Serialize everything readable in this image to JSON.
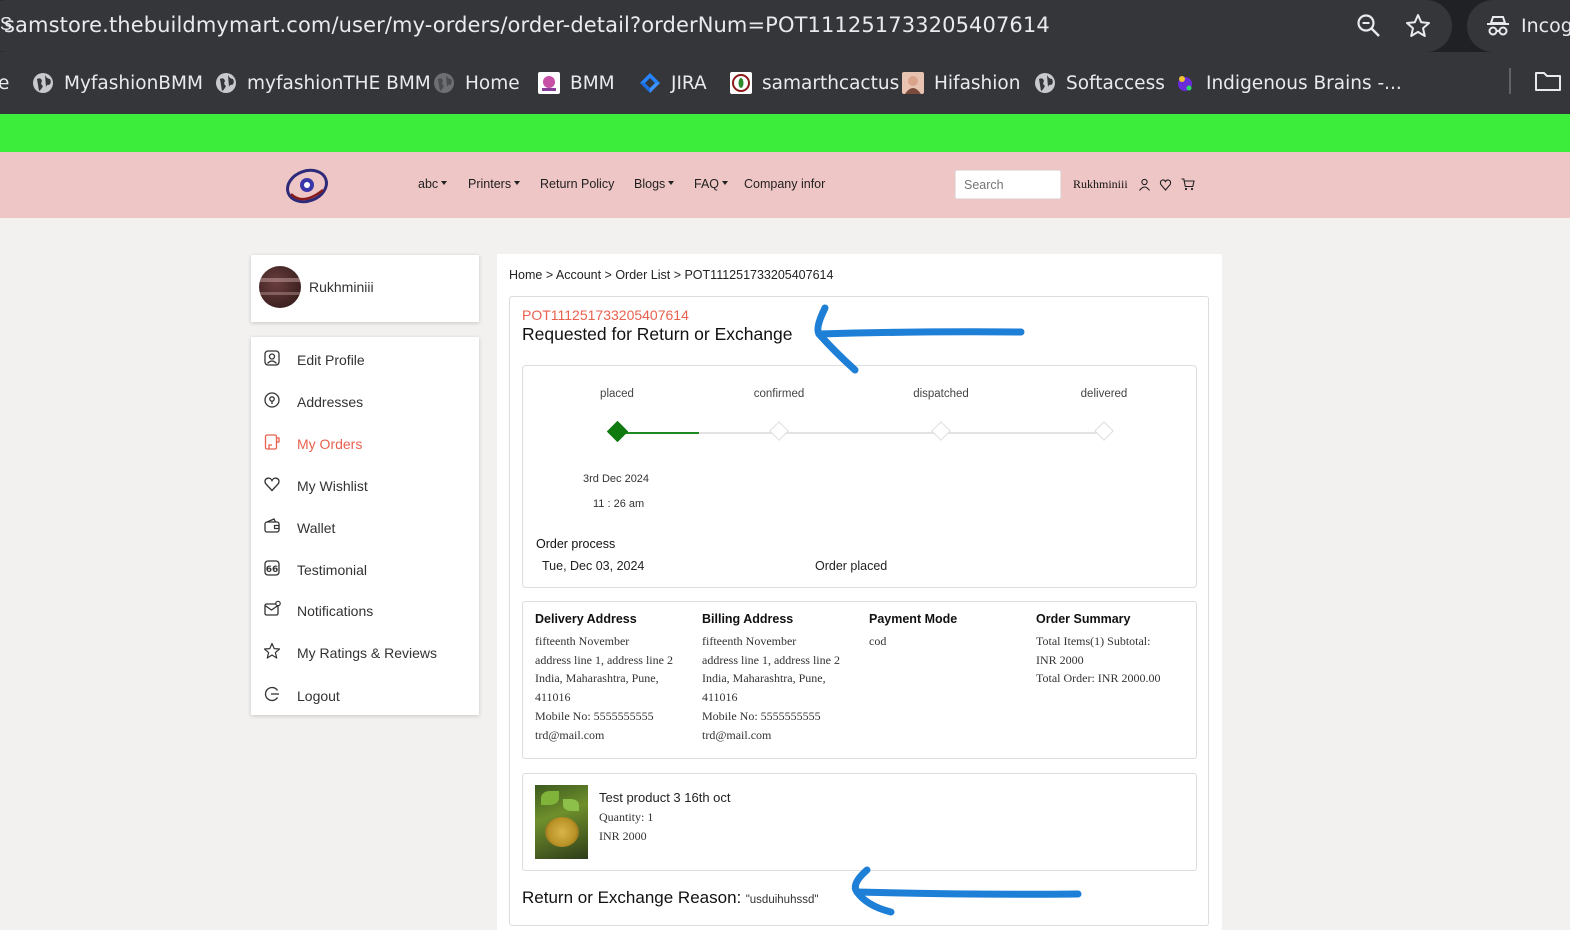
{
  "browser": {
    "url": "samstore.thebuildmymart.com/user/my-orders/order-detail?orderNum=POT111251733205407614",
    "url_edge": "S",
    "incognito_label": "Incogn",
    "bookmarks": [
      {
        "label": "e",
        "icon": "partial-icon"
      },
      {
        "label": "MyfashionBMM",
        "icon": "globe-icon"
      },
      {
        "label": "myfashionTHE BMM",
        "icon": "globe-icon"
      },
      {
        "label": "Home",
        "icon": "globe-dark-icon"
      },
      {
        "label": "BMM",
        "icon": "bmm-icon"
      },
      {
        "label": "JIRA",
        "icon": "jira-icon"
      },
      {
        "label": "samarthcactus",
        "icon": "cactus-icon"
      },
      {
        "label": "Hifashion",
        "icon": "avatar-icon"
      },
      {
        "label": "Softaccess",
        "icon": "globe-icon"
      },
      {
        "label": "Indigenous Brains -...",
        "icon": "brain-icon"
      }
    ]
  },
  "header": {
    "nav": [
      {
        "label": "abc",
        "dropdown": true
      },
      {
        "label": "Printers",
        "dropdown": true
      },
      {
        "label": "Return Policy",
        "dropdown": false
      },
      {
        "label": "Blogs",
        "dropdown": true
      },
      {
        "label": "FAQ",
        "dropdown": true
      },
      {
        "label": "Company infor",
        "dropdown": false
      }
    ],
    "search_placeholder": "Search",
    "username": "Rukhminiii"
  },
  "sidebar": {
    "profile_name": "Rukhminiii",
    "items": [
      {
        "label": "Edit Profile",
        "icon": "profile-icon",
        "active": false
      },
      {
        "label": "Addresses",
        "icon": "location-pin-icon",
        "active": false
      },
      {
        "label": "My Orders",
        "icon": "orders-icon",
        "active": true
      },
      {
        "label": "My Wishlist",
        "icon": "heart-icon",
        "active": false
      },
      {
        "label": "Wallet",
        "icon": "wallet-icon",
        "active": false
      },
      {
        "label": "Testimonial",
        "icon": "quote-icon",
        "active": false
      },
      {
        "label": "Notifications",
        "icon": "mail-notification-icon",
        "active": false
      },
      {
        "label": "My Ratings & Reviews",
        "icon": "star-icon",
        "active": false
      },
      {
        "label": "Logout",
        "icon": "logout-icon",
        "active": false
      }
    ]
  },
  "order": {
    "breadcrumb": [
      "Home",
      "Account",
      "Order List",
      "POT111251733205407614"
    ],
    "number": "POT111251733205407614",
    "status_title": "Requested for Return or Exchange",
    "steps": [
      {
        "label": "placed",
        "done": true
      },
      {
        "label": "confirmed",
        "done": false
      },
      {
        "label": "dispatched",
        "done": false
      },
      {
        "label": "delivered",
        "done": false
      }
    ],
    "step_date": "3rd Dec 2024",
    "step_time": "11 : 26 am",
    "process_title": "Order process",
    "process_date": "Tue, Dec 03, 2024",
    "process_status": "Order placed",
    "delivery": {
      "title": "Delivery Address",
      "lines": [
        "fifteenth November",
        "address line 1, address line 2",
        "India, Maharashtra, Pune,",
        "411016",
        "Mobile No: 5555555555",
        "trd@mail.com"
      ]
    },
    "billing": {
      "title": "Billing Address",
      "lines": [
        "fifteenth November",
        "address line 1, address line 2",
        "India, Maharashtra, Pune,",
        "411016",
        "Mobile No: 5555555555",
        "trd@mail.com"
      ]
    },
    "payment": {
      "title": "Payment Mode",
      "lines": [
        "cod"
      ]
    },
    "summary": {
      "title": "Order Summary",
      "lines": [
        "Total Items(1) Subtotal:",
        "INR 2000",
        "Total Order: INR 2000.00"
      ]
    },
    "product": {
      "name": "Test product 3 16th oct",
      "quantity": "Quantity: 1",
      "price": "INR 2000"
    },
    "reason_label": "Return or Exchange Reason:",
    "reason_value": "\"usduihuhssd\""
  },
  "colors": {
    "accent": "#e8614f",
    "done_green": "#0f7a10",
    "banner_green": "#3ded3b",
    "header_pink": "#efc6c6",
    "annotation_blue": "#1e7fd6"
  }
}
